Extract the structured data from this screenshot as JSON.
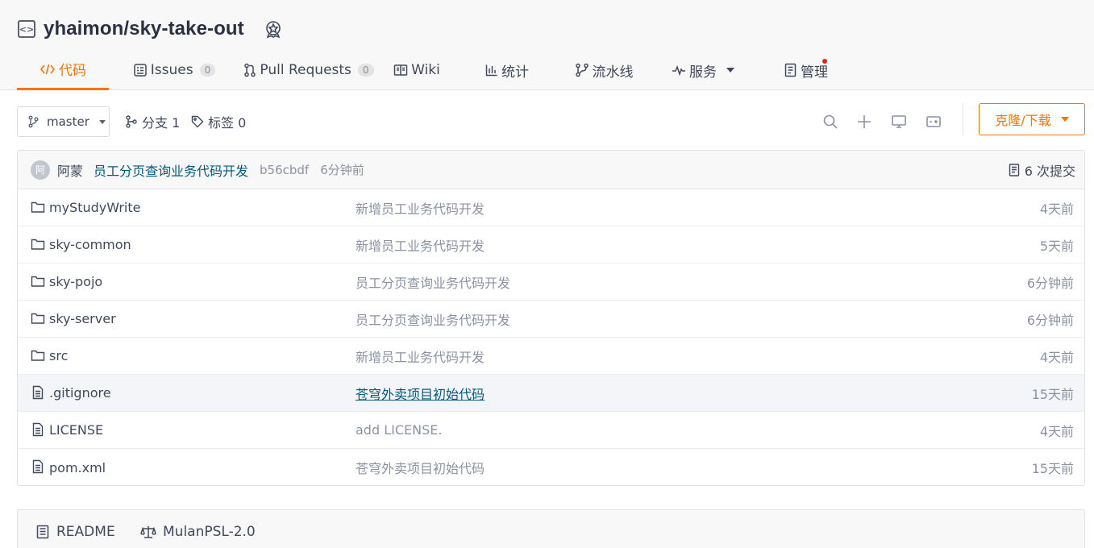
{
  "repo": {
    "full_name": "yhaimon/sky-take-out",
    "icon": "code-icon",
    "badge_icon": "award-badge-icon"
  },
  "tabs": [
    {
      "label": "代码",
      "icon": "code-brackets-icon",
      "active": true
    },
    {
      "label": "Issues",
      "count": "0",
      "icon": "issues-icon"
    },
    {
      "label": "Pull Requests",
      "count": "0",
      "icon": "pull-request-icon"
    },
    {
      "label": "Wiki",
      "icon": "book-icon"
    },
    {
      "label": "统计",
      "icon": "bar-chart-icon"
    },
    {
      "label": "流水线",
      "icon": "pipeline-icon"
    },
    {
      "label": "服务",
      "icon": "pulse-icon"
    },
    {
      "label": "管理",
      "icon": "manage-icon"
    }
  ],
  "toolbar": {
    "branch": "master",
    "branches_label": "分支 1",
    "tags_label": "标签 0",
    "clone_label": "克隆/下载"
  },
  "latest_commit": {
    "avatar_text": "阿",
    "author": "阿蒙",
    "message": "员工分页查询业务代码开发",
    "sha": "b56cbdf",
    "time": "6分钟前",
    "commit_count_label": "6 次提交"
  },
  "files": [
    {
      "name": "myStudyWrite",
      "type": "folder",
      "message": "新增员工业务代码开发",
      "time": "4天前"
    },
    {
      "name": "sky-common",
      "type": "folder",
      "message": "新增员工业务代码开发",
      "time": "5天前"
    },
    {
      "name": "sky-pojo",
      "type": "folder",
      "message": "员工分页查询业务代码开发",
      "time": "6分钟前"
    },
    {
      "name": "sky-server",
      "type": "folder",
      "message": "员工分页查询业务代码开发",
      "time": "6分钟前"
    },
    {
      "name": "src",
      "type": "folder",
      "message": "新增员工业务代码开发",
      "time": "4天前"
    },
    {
      "name": ".gitignore",
      "type": "file",
      "message": "苍穹外卖项目初始代码",
      "time": "15天前",
      "hover": true
    },
    {
      "name": "LICENSE",
      "type": "file",
      "message": "add LICENSE.",
      "time": "4天前"
    },
    {
      "name": "pom.xml",
      "type": "file",
      "message": "苍穹外卖项目初始代码",
      "time": "15天前"
    }
  ],
  "readme_tabs": [
    {
      "label": "README",
      "icon": "readme-icon"
    },
    {
      "label": "MulanPSL-2.0",
      "icon": "scale-icon"
    }
  ],
  "colors": {
    "accent": "#fe7300",
    "link": "#005980",
    "muted": "#8c92a4",
    "text": "#40485b"
  }
}
